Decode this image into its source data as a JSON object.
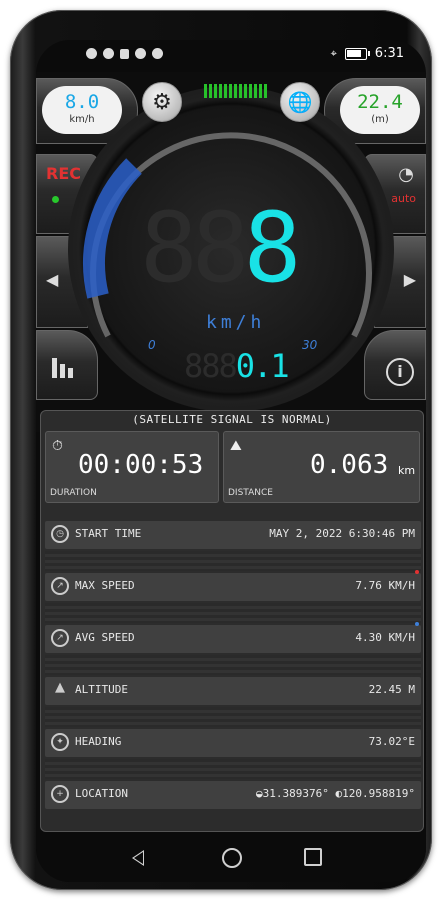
{
  "status_bar": {
    "time": "6:31",
    "battery_label": "battery"
  },
  "gauge": {
    "left_pill": {
      "value": "8.0",
      "unit": "km/h",
      "color": "#19a7e6"
    },
    "right_pill": {
      "value": "22.4",
      "unit": "(m)",
      "color": "#27a32a"
    },
    "big_digits_ghost": "88",
    "big_digits_lit": "8",
    "unit": "km/h",
    "scale_min": "0",
    "scale_max": "30",
    "odometer_ghost": "888",
    "odometer_lit": "0.1",
    "rec_label": "REC",
    "auto_label": "auto"
  },
  "panel": {
    "satellite": "(SATELLITE SIGNAL IS NORMAL)",
    "duration_value": "00:00:53",
    "duration_label": "DURATION",
    "distance_value": "0.063",
    "distance_unit": "km",
    "distance_label": "DISTANCE",
    "rows": [
      {
        "label": "START TIME",
        "value": "MAY 2, 2022 6:30:46 PM"
      },
      {
        "label": "MAX SPEED",
        "value": "7.76 KM/H"
      },
      {
        "label": "AVG SPEED",
        "value": "4.30 KM/H"
      },
      {
        "label": "ALTITUDE",
        "value": "22.45 M"
      },
      {
        "label": "HEADING",
        "value": "73.02°E"
      },
      {
        "label": "LOCATION",
        "value": "◒31.389376° ◐120.958819°"
      }
    ],
    "max_dot_color": "#e23232",
    "avg_dot_color": "#3e7fd8"
  }
}
